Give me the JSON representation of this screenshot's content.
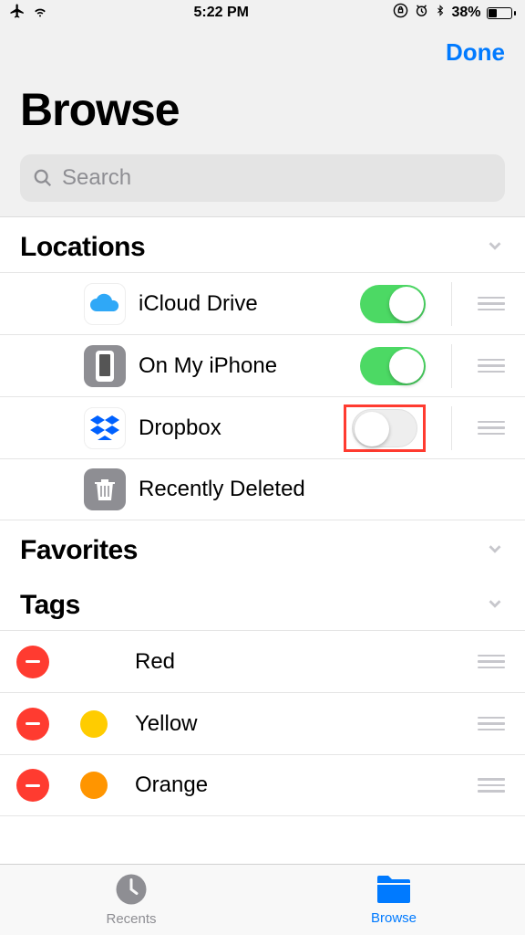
{
  "status": {
    "time": "5:22 PM",
    "battery_pct": "38%"
  },
  "header": {
    "done": "Done",
    "title": "Browse",
    "search_placeholder": "Search"
  },
  "sections": {
    "locations": {
      "title": "Locations",
      "items": [
        {
          "label": "iCloud Drive",
          "enabled": true
        },
        {
          "label": "On My iPhone",
          "enabled": true
        },
        {
          "label": "Dropbox",
          "enabled": false,
          "highlighted": true
        },
        {
          "label": "Recently Deleted"
        }
      ]
    },
    "favorites": {
      "title": "Favorites"
    },
    "tags": {
      "title": "Tags",
      "items": [
        {
          "label": "Red",
          "color": "#ff3b30"
        },
        {
          "label": "Yellow",
          "color": "#ffcc00"
        },
        {
          "label": "Orange",
          "color": "#ff9500"
        }
      ]
    }
  },
  "tabs": {
    "recents": "Recents",
    "browse": "Browse"
  }
}
